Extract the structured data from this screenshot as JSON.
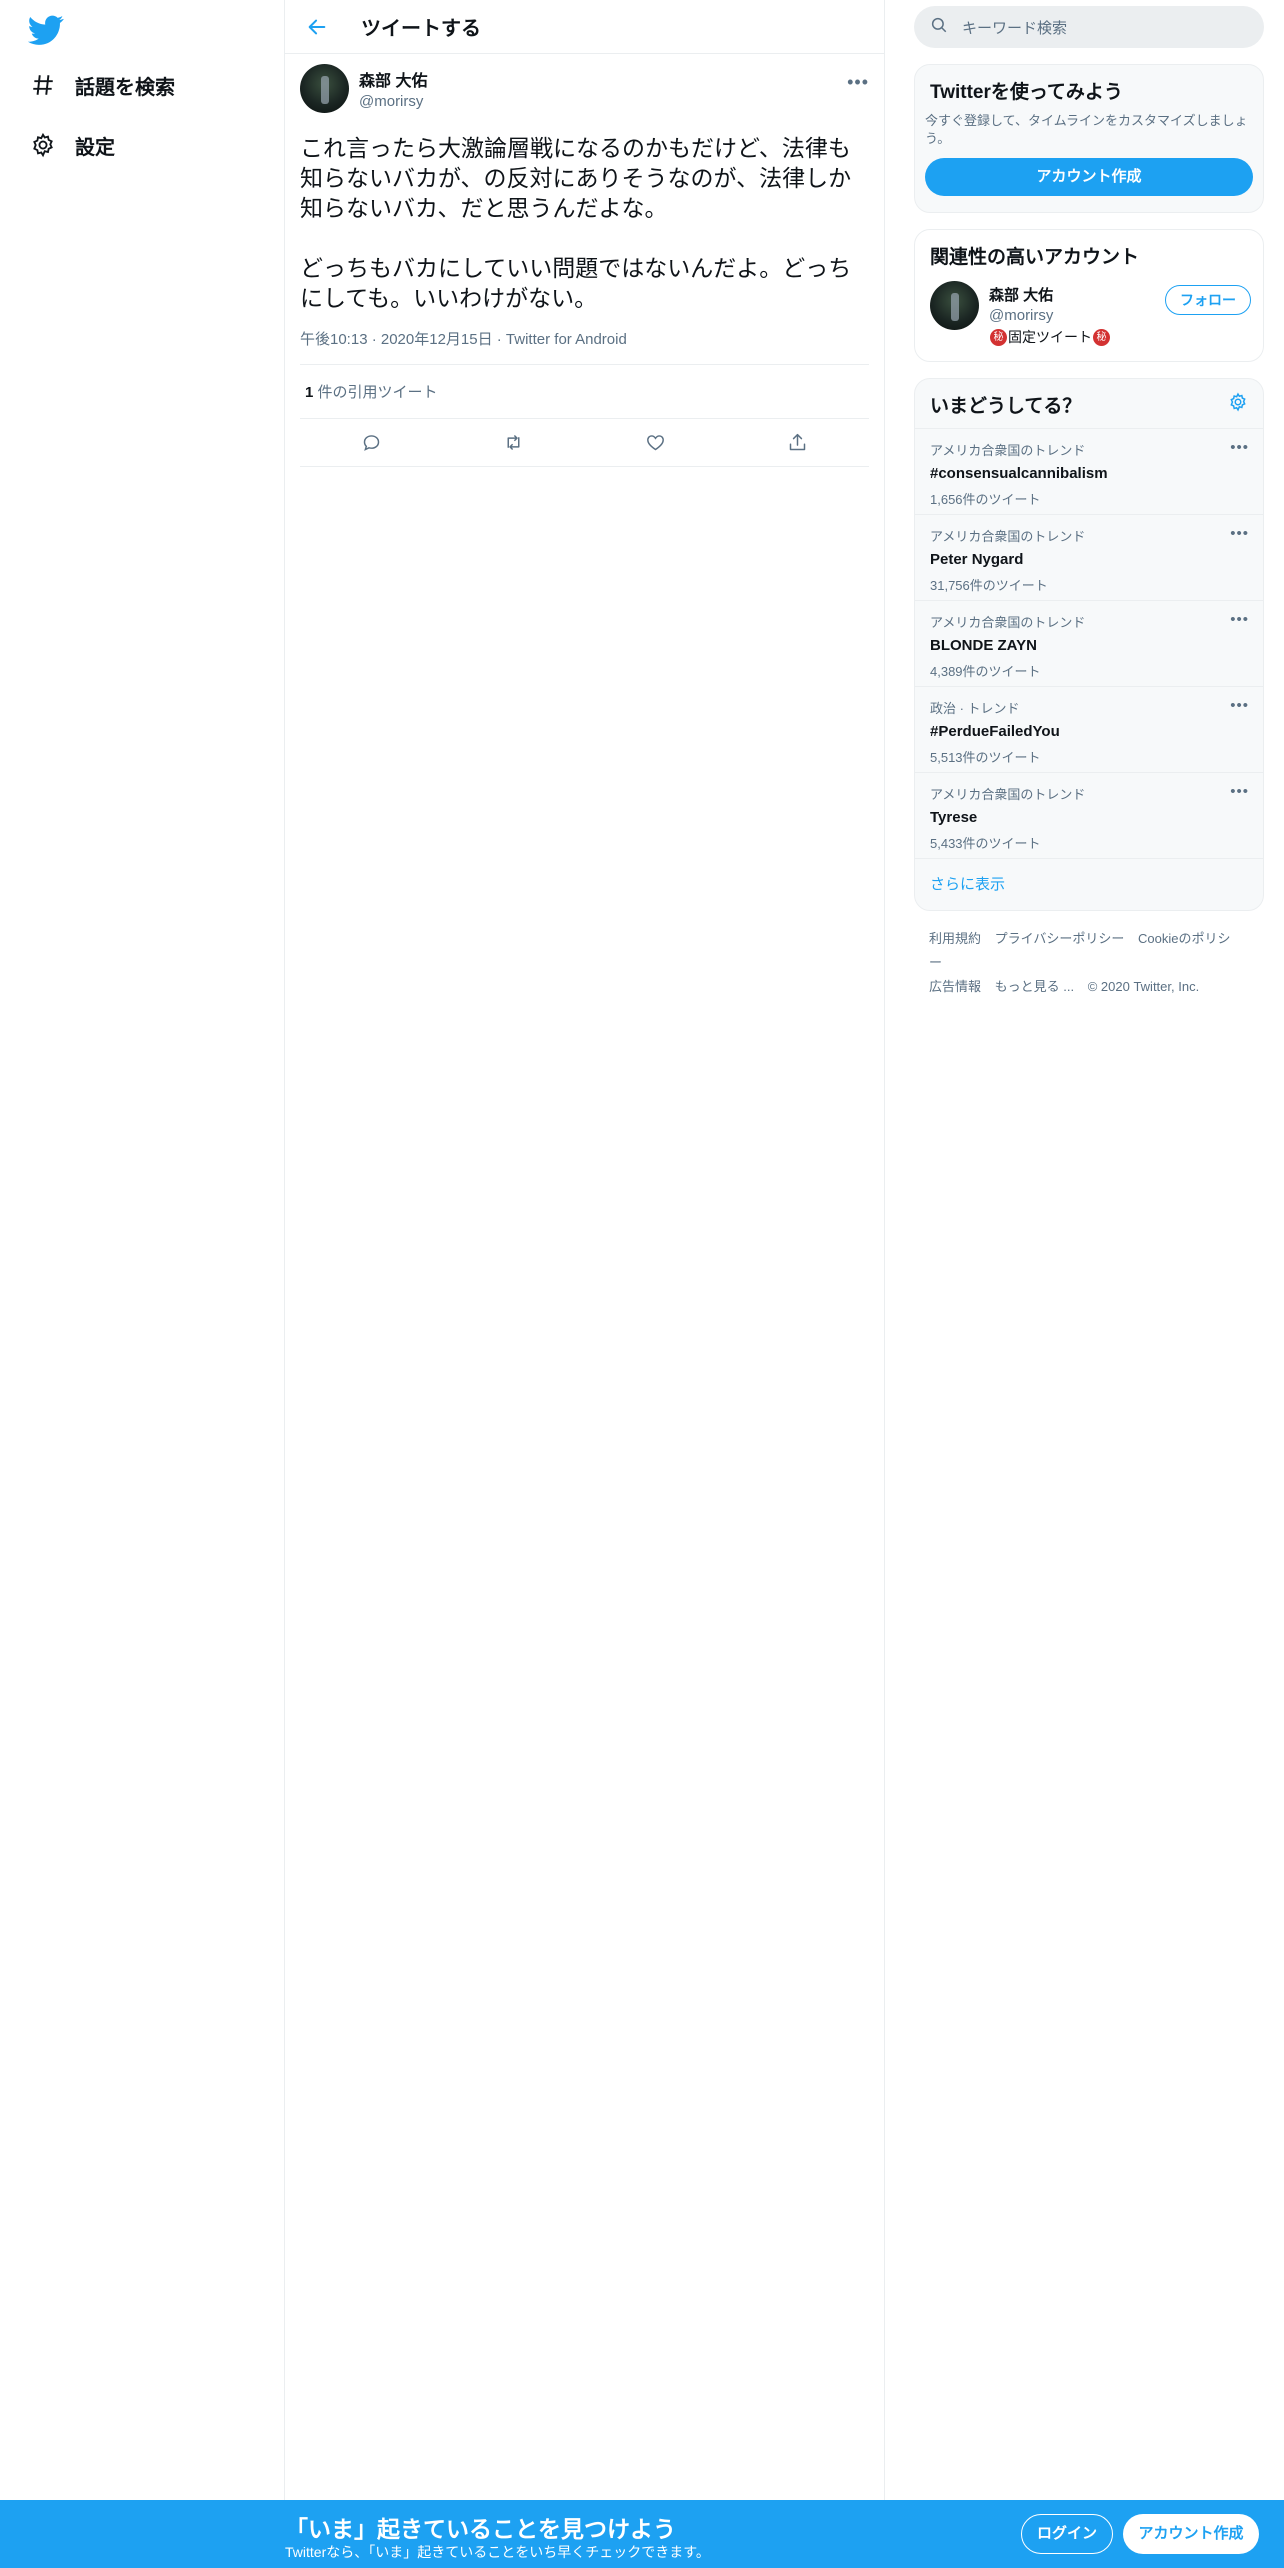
{
  "colors": {
    "accent": "#1da1f2",
    "secondary_text": "#5b7083",
    "seal": "#d33232"
  },
  "nav": {
    "logo_icon": "twitter-bird-icon",
    "items": [
      {
        "label": "話題を検索",
        "icon": "hashtag-icon"
      },
      {
        "label": "設定",
        "icon": "gear-icon"
      }
    ]
  },
  "header": {
    "title": "ツイートする"
  },
  "tweet": {
    "name": "森部 大佑",
    "handle": "@morirsy",
    "text": "これ言ったら大激論層戦になるのかもだけど、法律も知らないバカが、の反対にありそうなのが、法律しか知らないバカ、だと思うんだよな。\n\nどっちもバカにしていい問題ではないんだよ。どっちにしても。いいわけがない。",
    "meta": "午後10:13 · 2020年12月15日 · Twitter for Android",
    "quote_count": "1",
    "quote_label": " 件の引用ツイート"
  },
  "search": {
    "placeholder": "キーワード検索"
  },
  "signup_card": {
    "title": "Twitterを使ってみよう",
    "subtitle": "今すぐ登録して、タイムラインをカスタマイズしましょう。",
    "button": "アカウント作成"
  },
  "related": {
    "title": "関連性の高いアカウント",
    "name": "森部 大佑",
    "handle": "@morirsy",
    "seal": "秘",
    "bio": "固定ツイート",
    "follow": "フォロー"
  },
  "trends": {
    "title": "いまどうしてる？",
    "items": [
      {
        "context": "アメリカ合衆国のトレンド",
        "name": "#consensualcannibalism",
        "count": "1,656件のツイート"
      },
      {
        "context": "アメリカ合衆国のトレンド",
        "name": "Peter Nygard",
        "count": "31,756件のツイート"
      },
      {
        "context": "アメリカ合衆国のトレンド",
        "name": "BLONDE ZAYN",
        "count": "4,389件のツイート"
      },
      {
        "context": "政治 · トレンド",
        "name": "#PerdueFailedYou",
        "count": "5,513件のツイート"
      },
      {
        "context": "アメリカ合衆国のトレンド",
        "name": "Tyrese",
        "count": "5,433件のツイート"
      }
    ],
    "show_more": "さらに表示"
  },
  "footer": {
    "links": [
      "利用規約",
      "プライバシーポリシー",
      "Cookieのポリシー",
      "広告情報",
      "もっと見る ..."
    ],
    "copyright": "© 2020 Twitter, Inc."
  },
  "banner": {
    "title": "「いま」起きていることを見つけよう",
    "subtitle": "Twitterなら、「いま」起きていることをいち早くチェックできます。",
    "login": "ログイン",
    "signup": "アカウント作成"
  }
}
